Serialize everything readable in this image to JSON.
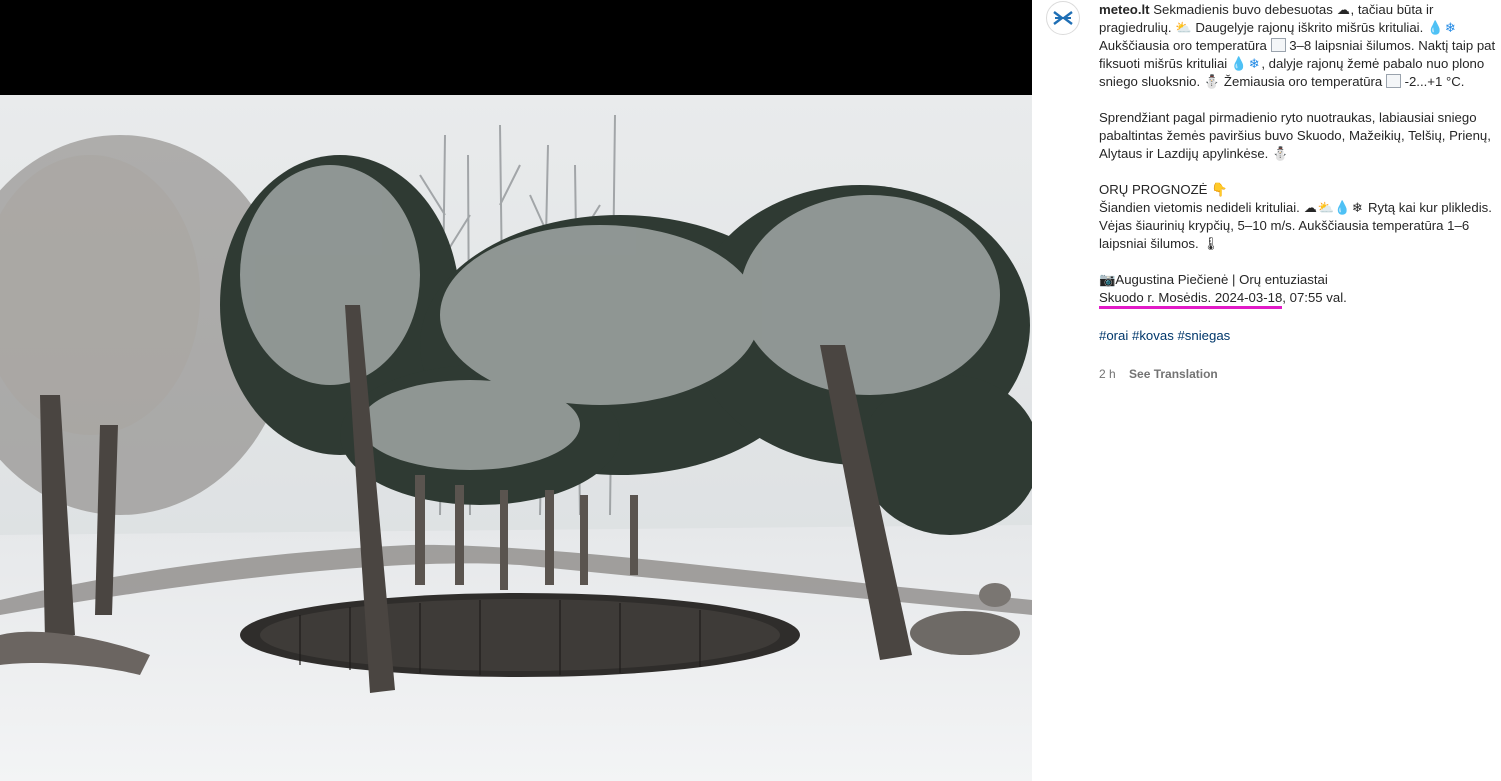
{
  "post": {
    "username": "meteo.lt",
    "caption": {
      "p1_a": " Sekmadienis buvo debesuotas ",
      "p1_b": ", tačiau būta ir pragiedrulių. ",
      "p1_c": " Daugelyje rajonų iškrito mišrūs krituliai. ",
      "p1_d": " Aukščiausia oro temperatūra ",
      "p1_e": " 3–8 laipsniai šilumos. Naktį taip pat fiksuoti mišrūs krituliai ",
      "p1_f": ", dalyje rajonų žemė pabalo nuo plono sniego sluoksnio. ",
      "p1_g": " Žemiausia oro temperatūra ",
      "p1_h": " -2...+1 °C.",
      "p2": "Sprendžiant pagal pirmadienio ryto nuotraukas, labiausiai sniego pabaltintas žemės paviršius buvo Skuodo, Mažeikių, Telšių, Prienų, Alytaus ir Lazdijų apylinkėse. ",
      "forecast_heading": "ORŲ PROGNOZĖ ",
      "forecast_a": "Šiandien vietomis nedideli krituliai. ",
      "forecast_b": " Rytą kai kur plikledis. Vėjas šiaurinių krypčių, 5–10 m/s. Aukščiausia temperatūra 1–6 laipsniai šilumos. ",
      "credit": "Augustina Piečienė | Orų entuziastai",
      "location_marked": "Skuodo r. Mosėdis. 2024-03-18",
      "location_rest": ", 07:55 val."
    },
    "emoji": {
      "cloud": "☁",
      "sun_cloud": "⛅",
      "drop": "💧",
      "snowflake": "❄",
      "snowman": "⛄",
      "point_down": "👇",
      "thermometer": "🌡",
      "camera": "📷"
    },
    "hashtags": [
      "#orai",
      "#kovas",
      "#sniegas"
    ],
    "time_ago": "2 h",
    "see_translation": "See Translation"
  },
  "colors": {
    "highlight_underline": "#e21ac7",
    "hashtag": "#00376b",
    "meta_text": "#737373",
    "brand": "#1f6fb5"
  },
  "icons": {
    "avatar": "meteo-logo-icon"
  }
}
